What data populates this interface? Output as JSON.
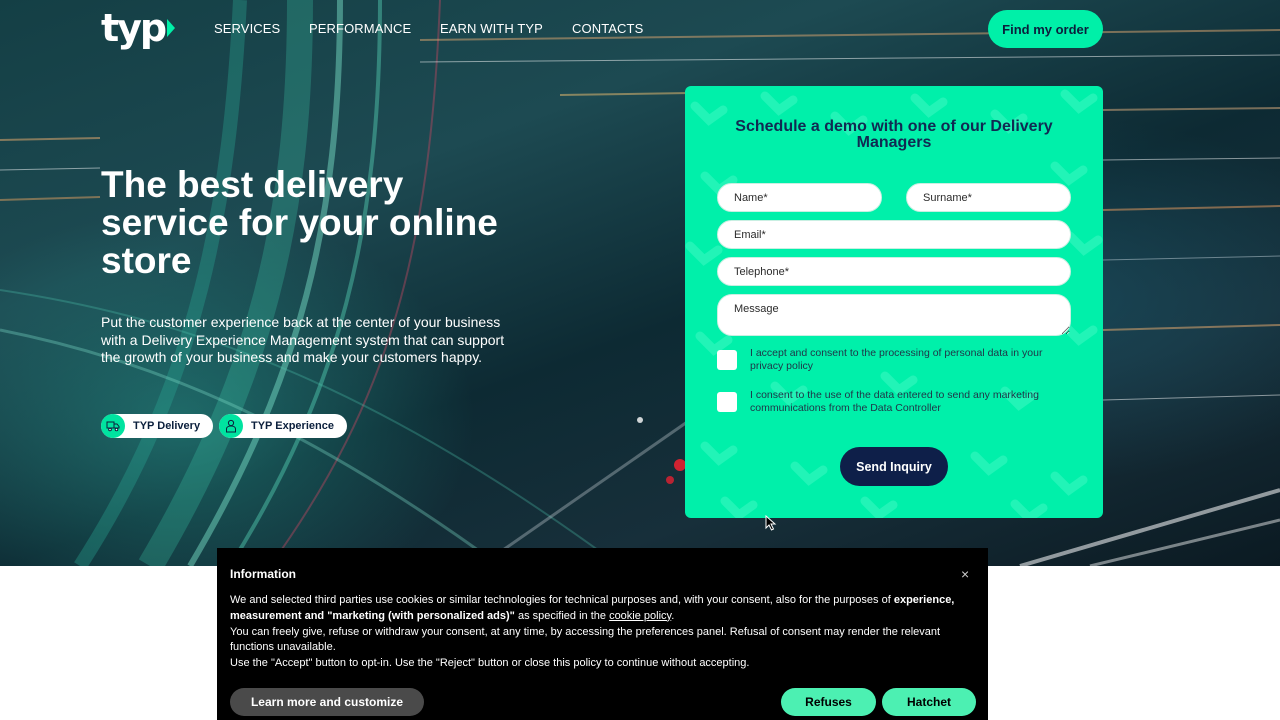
{
  "nav": {
    "logo": "typ",
    "links": [
      "SERVICES",
      "PERFORMANCE",
      "EARN WITH TYP",
      "CONTACTS"
    ],
    "find_order": "Find my order"
  },
  "hero": {
    "title": "The best delivery service for your online store",
    "subtitle": "Put the customer experience back at the center of your business with a Delivery Experience Management system that can support the growth of your business and make your customers happy.",
    "pills": [
      {
        "label": "TYP Delivery",
        "icon": "truck-icon"
      },
      {
        "label": "TYP Experience",
        "icon": "user-icon"
      }
    ]
  },
  "form": {
    "title": "Schedule a demo with one of our Delivery Managers",
    "name_placeholder": "Name*",
    "surname_placeholder": "Surname*",
    "email_placeholder": "Email*",
    "telephone_placeholder": "Telephone*",
    "message_placeholder": "Message",
    "consent_privacy": "I accept and consent to the processing of personal data in your privacy policy",
    "consent_marketing": "I consent to the use of the data entered to send any marketing communications from the Data Controller",
    "submit": "Send Inquiry"
  },
  "cookie": {
    "title": "Information",
    "close": "×",
    "text_1": "We and selected third parties use cookies or similar technologies for technical purposes and, with your consent, also for the purposes of ",
    "text_bold": "experience, measurement and \"marketing (with personalized ads)\"",
    "text_2": " as specified in the ",
    "link": "cookie policy",
    "text_3": ".",
    "text_4": "You can freely give, refuse or withdraw your consent, at any time, by accessing the preferences panel. Refusal of consent may render the relevant functions unavailable.",
    "text_5": "Use the \"Accept\" button to opt-in. Use the \"Reject\" button or close this policy to continue without accepting.",
    "learn_more": "Learn more and customize",
    "refuse": "Refuses",
    "accept": "Hatchet"
  },
  "colors": {
    "accent": "#00f0a8",
    "navy": "#0e1f49",
    "cookie_bg": "#000000",
    "cookie_btn": "#4cf0b2"
  }
}
